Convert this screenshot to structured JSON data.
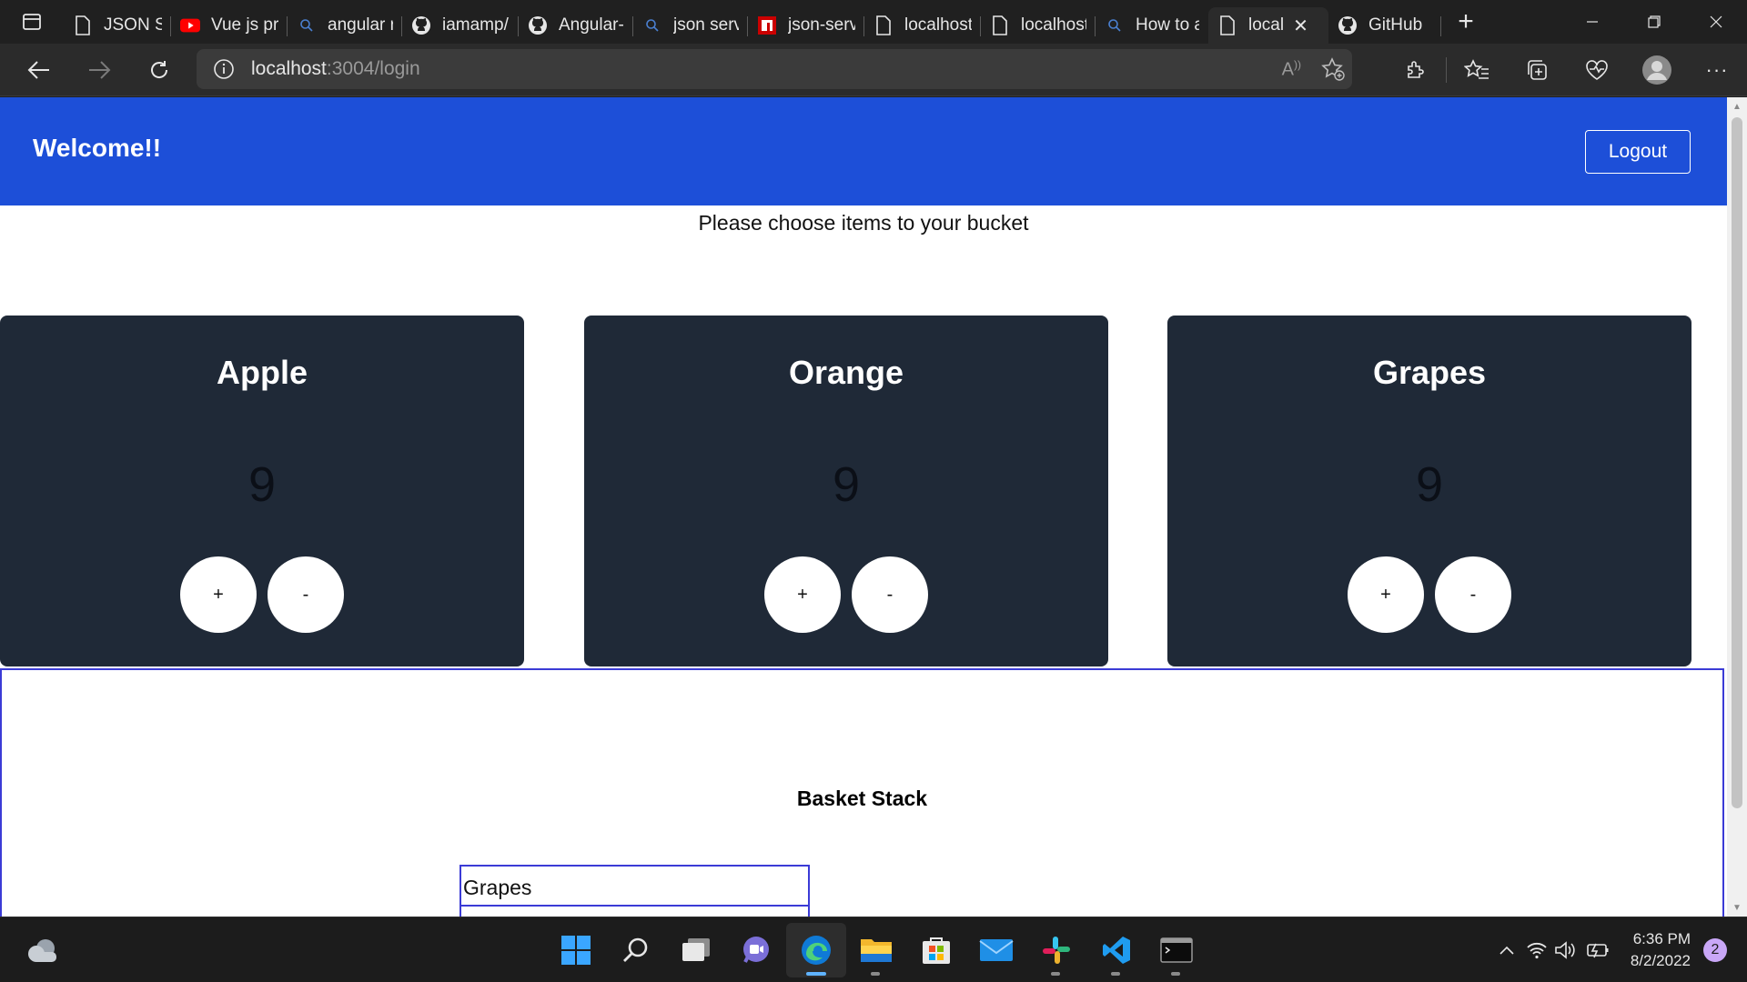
{
  "browser": {
    "tabs": [
      {
        "label": "JSON Ser",
        "icon": "page-icon",
        "active": false
      },
      {
        "label": "Vue js pr",
        "icon": "youtube-icon",
        "active": false
      },
      {
        "label": "angular r",
        "icon": "search-icon",
        "active": false
      },
      {
        "label": "iamamp/",
        "icon": "github-icon",
        "active": false
      },
      {
        "label": "Angular-",
        "icon": "github-icon",
        "active": false
      },
      {
        "label": "json serv",
        "icon": "search-icon",
        "active": false
      },
      {
        "label": "json-serv",
        "icon": "npm-icon",
        "active": false
      },
      {
        "label": "localhost",
        "icon": "page-icon",
        "active": false
      },
      {
        "label": "localhost",
        "icon": "page-icon",
        "active": false
      },
      {
        "label": "How to a",
        "icon": "search-icon",
        "active": false
      },
      {
        "label": "local",
        "icon": "page-icon",
        "active": true
      },
      {
        "label": "GitHub",
        "icon": "github-icon",
        "active": false
      }
    ],
    "url_host": "localhost",
    "url_path": ":3004/login"
  },
  "app": {
    "title": "Welcome!!",
    "logout_label": "Logout",
    "subtitle": "Please choose items to your bucket",
    "cards": [
      {
        "name": "Apple",
        "count": "9",
        "plus": "+",
        "minus": "-"
      },
      {
        "name": "Orange",
        "count": "9",
        "plus": "+",
        "minus": "-"
      },
      {
        "name": "Grapes",
        "count": "9",
        "plus": "+",
        "minus": "-"
      }
    ],
    "basket": {
      "title": "Basket Stack",
      "items": [
        "Grapes"
      ]
    }
  },
  "taskbar": {
    "apps": [
      "windows-start",
      "search",
      "task-view",
      "teams-chat",
      "edge",
      "file-explorer",
      "microsoft-store",
      "mail",
      "slack",
      "vscode",
      "terminal"
    ],
    "time": "6:36 PM",
    "date": "8/2/2022",
    "notification_count": "2"
  },
  "colors": {
    "app_bar": "#1d4fd8",
    "card_bg": "#1f2937",
    "basket_border": "#3b3bd6"
  }
}
